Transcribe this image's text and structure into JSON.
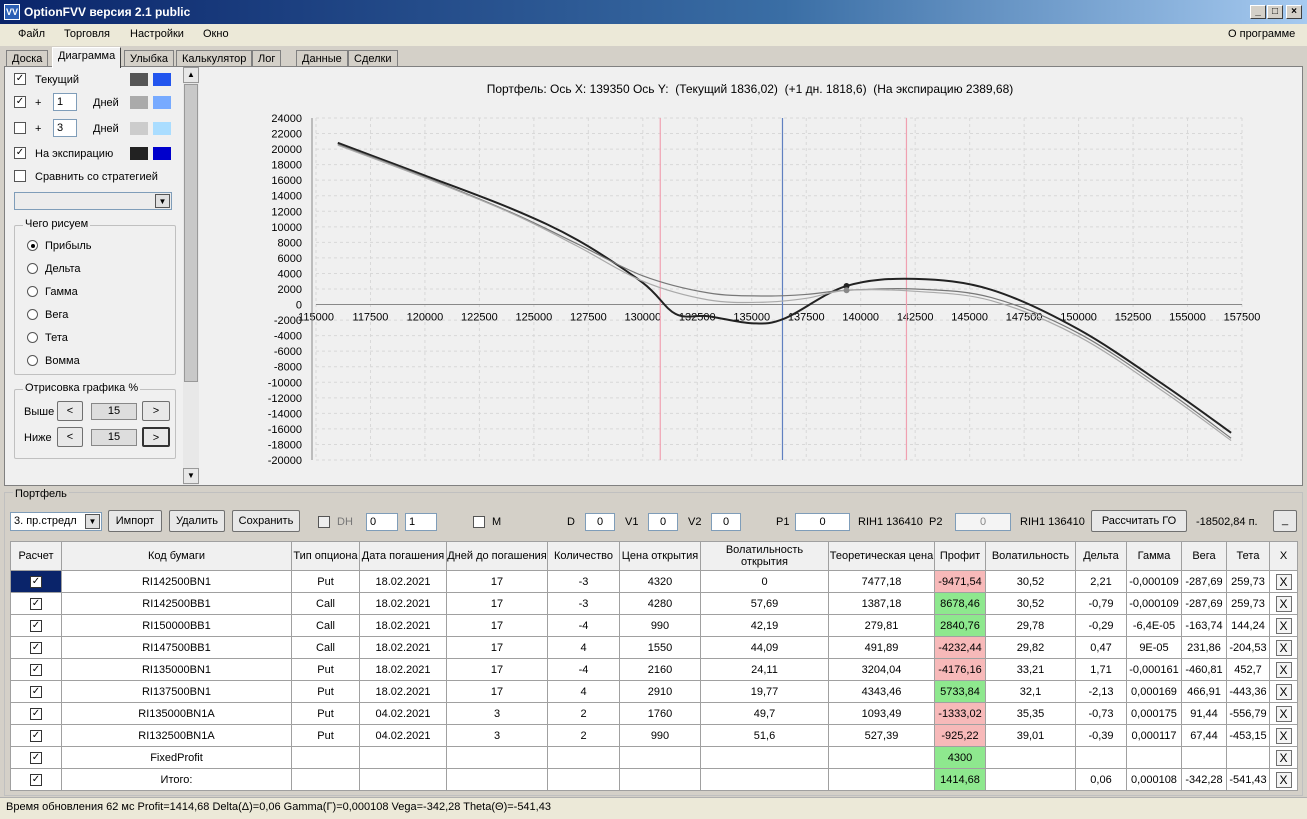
{
  "window": {
    "title": "OptionFVV версия 2.1 public",
    "icon": "app-icon"
  },
  "menu": {
    "items": [
      "Файл",
      "Торговля",
      "Настройки",
      "Окно"
    ],
    "right": "О программе"
  },
  "tabs": [
    "Доска",
    "Диаграмма",
    "Улыбка",
    "Калькулятор",
    "Лог",
    "Данные",
    "Сделки"
  ],
  "left": {
    "cur_label": "Текущий",
    "plus": "+",
    "days": "Дней",
    "d1": "1",
    "d2": "3",
    "exp_label": "На экспирацию",
    "compare_label": "Сравнить со стратегией",
    "group_title": "Чего рисуем",
    "radios": [
      "Прибыль",
      "Дельта",
      "Гамма",
      "Вега",
      "Тета",
      "Вомма"
    ],
    "draw_title": "Отрисовка графика %",
    "above": "Выше",
    "below": "Ниже",
    "above_val": "15",
    "below_val": "15",
    "btn_left": "<",
    "btn_right": ">",
    "down_arrow": "▼",
    "up_arrow": "▲",
    "colors": {
      "cur1": "#555555",
      "cur2": "#2255ee",
      "p1a": "#aaaaaa",
      "p1b": "#77aaff",
      "p3a": "#cccccc",
      "p3b": "#aaddff",
      "exp1": "#222222",
      "exp2": "#0000cc"
    }
  },
  "chart_data": {
    "type": "line",
    "title": "Портфель: Ось X: 139350 Ось Y:  (Текущий 1836,02)  (+1 дн. 1818,6)  (На экспирацию 2389,68)",
    "xlim": [
      115000,
      157500
    ],
    "ylim": [
      -20000,
      24000
    ],
    "xticks": [
      115000,
      117500,
      120000,
      122500,
      125000,
      127500,
      130000,
      132500,
      135000,
      137500,
      140000,
      142500,
      145000,
      147500,
      150000,
      152500,
      155000,
      157500
    ],
    "yticks": [
      24000,
      22000,
      20000,
      18000,
      16000,
      14000,
      12000,
      10000,
      8000,
      6000,
      4000,
      2000,
      0,
      -2000,
      -4000,
      -6000,
      -8000,
      -10000,
      -12000,
      -14000,
      -16000,
      -18000,
      -20000
    ],
    "vlines": [
      {
        "x": 130800,
        "color": "#f0a0b0"
      },
      {
        "x": 136410,
        "color": "#6080c0"
      },
      {
        "x": 142100,
        "color": "#f0a0b0"
      }
    ],
    "cursor": {
      "x": 139350,
      "y": 2389.68
    },
    "series": [
      {
        "color": "#222222",
        "width": 2,
        "x": [
          116000,
          120000,
          124000,
          127000,
          130000,
          131500,
          133000,
          135000,
          136500,
          139350,
          142500,
          146000,
          150000,
          154000,
          157000
        ],
        "y": [
          20800,
          16600,
          12300,
          8300,
          2800,
          -1200,
          -1500,
          -2400,
          -1800,
          2389.68,
          3300,
          1900,
          -3200,
          -10500,
          -16500
        ]
      },
      {
        "color": "#777777",
        "width": 1.2,
        "x": [
          116000,
          120000,
          124000,
          127000,
          130000,
          133000,
          135500,
          137500,
          139350,
          142500,
          146000,
          150000,
          154000,
          157000
        ],
        "y": [
          20600,
          16400,
          11800,
          7800,
          3700,
          1500,
          1100,
          1300,
          1836.02,
          2000,
          900,
          -3700,
          -11000,
          -17200
        ]
      },
      {
        "color": "#aaaaaa",
        "width": 1.2,
        "x": [
          116000,
          120000,
          124000,
          127000,
          130000,
          133000,
          135500,
          137500,
          139350,
          142500,
          146000,
          150000,
          154000,
          157000
        ],
        "y": [
          20500,
          16300,
          11700,
          7500,
          3000,
          600,
          300,
          800,
          1818.6,
          1700,
          500,
          -4100,
          -11400,
          -17500
        ]
      }
    ]
  },
  "portfolio": {
    "title": "Портфель",
    "strategy": "3. пр.стредл",
    "import": "Импорт",
    "delete": "Удалить",
    "save": "Сохранить",
    "dh": "DH",
    "dh_v1": "0",
    "dh_v2": "1",
    "m": "M",
    "d_label": "D",
    "d_val": "0",
    "v1_label": "V1",
    "v1_val": "0",
    "v2_label": "V2",
    "v2_val": "0",
    "p1_label": "P1",
    "p1_val": "0",
    "rih1": "RIH1 136410",
    "p2_label": "P2",
    "p2_val": "0",
    "rih2": "RIH1 136410",
    "calc_btn": "Рассчитать ГО",
    "go_value": "-18502,84 п.",
    "minimize": "_"
  },
  "table": {
    "headers": [
      "Расчет",
      "Код бумаги",
      "Тип опциона",
      "Дата погашения",
      "Дней до погашения",
      "Количество",
      "Цена открытия",
      "Волатильность открытия",
      "Теоретическая цена",
      "Профит",
      "Волатильность",
      "Дельта",
      "Гамма",
      "Вега",
      "Тета",
      "X"
    ],
    "rows": [
      [
        "RI142500BN1",
        "Put",
        "18.02.2021",
        "17",
        "-3",
        "4320",
        "0",
        "7477,18",
        "-9471,54",
        "30,52",
        "2,21",
        "-0,000109",
        "-287,69",
        "259,73"
      ],
      [
        "RI142500BB1",
        "Call",
        "18.02.2021",
        "17",
        "-3",
        "4280",
        "57,69",
        "1387,18",
        "8678,46",
        "30,52",
        "-0,79",
        "-0,000109",
        "-287,69",
        "259,73"
      ],
      [
        "RI150000BB1",
        "Call",
        "18.02.2021",
        "17",
        "-4",
        "990",
        "42,19",
        "279,81",
        "2840,76",
        "29,78",
        "-0,29",
        "-6,4E-05",
        "-163,74",
        "144,24"
      ],
      [
        "RI147500BB1",
        "Call",
        "18.02.2021",
        "17",
        "4",
        "1550",
        "44,09",
        "491,89",
        "-4232,44",
        "29,82",
        "0,47",
        "9E-05",
        "231,86",
        "-204,53"
      ],
      [
        "RI135000BN1",
        "Put",
        "18.02.2021",
        "17",
        "-4",
        "2160",
        "24,11",
        "3204,04",
        "-4176,16",
        "33,21",
        "1,71",
        "-0,000161",
        "-460,81",
        "452,7"
      ],
      [
        "RI137500BN1",
        "Put",
        "18.02.2021",
        "17",
        "4",
        "2910",
        "19,77",
        "4343,46",
        "5733,84",
        "32,1",
        "-2,13",
        "0,000169",
        "466,91",
        "-443,36"
      ],
      [
        "RI135000BN1A",
        "Put",
        "04.02.2021",
        "3",
        "2",
        "1760",
        "49,7",
        "1093,49",
        "-1333,02",
        "35,35",
        "-0,73",
        "0,000175",
        "91,44",
        "-556,79"
      ],
      [
        "RI132500BN1A",
        "Put",
        "04.02.2021",
        "3",
        "2",
        "990",
        "51,6",
        "527,39",
        "-925,22",
        "39,01",
        "-0,39",
        "0,000117",
        "67,44",
        "-453,15"
      ]
    ],
    "fixed": {
      "name": "FixedProfit",
      "profit": "4300"
    },
    "total": {
      "name": "Итого:",
      "profit": "1414,68",
      "delta": "0,06",
      "gamma": "0,000108",
      "vega": "-342,28",
      "theta": "-541,43"
    },
    "check": "✓",
    "close": "X"
  },
  "status": "Время обновления 62 мс  Profit=1414,68 Delta(Δ)=0,06 Gamma(Γ)=0,000108 Vega=-342,28 Theta(Θ)=-541,43"
}
